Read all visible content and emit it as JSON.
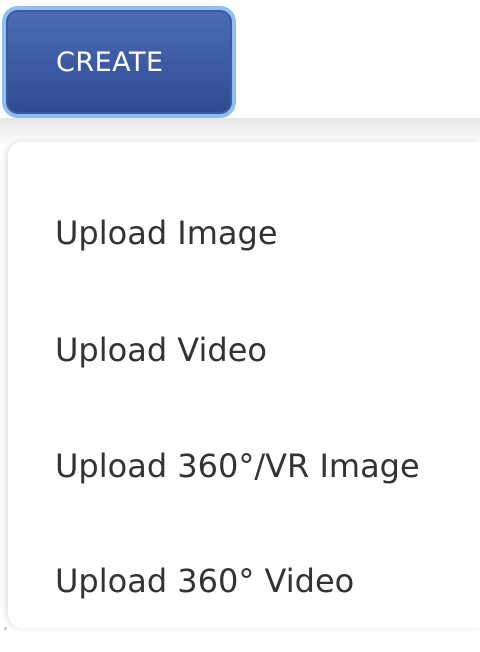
{
  "create_button": {
    "label": "CREATE"
  },
  "menu": {
    "items": [
      {
        "label": "Upload Image"
      },
      {
        "label": "Upload Video"
      },
      {
        "label": "Upload 360°/VR Image"
      },
      {
        "label": "Upload 360° Video"
      }
    ]
  },
  "colors": {
    "button_bg": "#3d5ba5",
    "button_focus_ring": "#8fbff0",
    "menu_text": "#333333",
    "background": "#ffffff"
  }
}
